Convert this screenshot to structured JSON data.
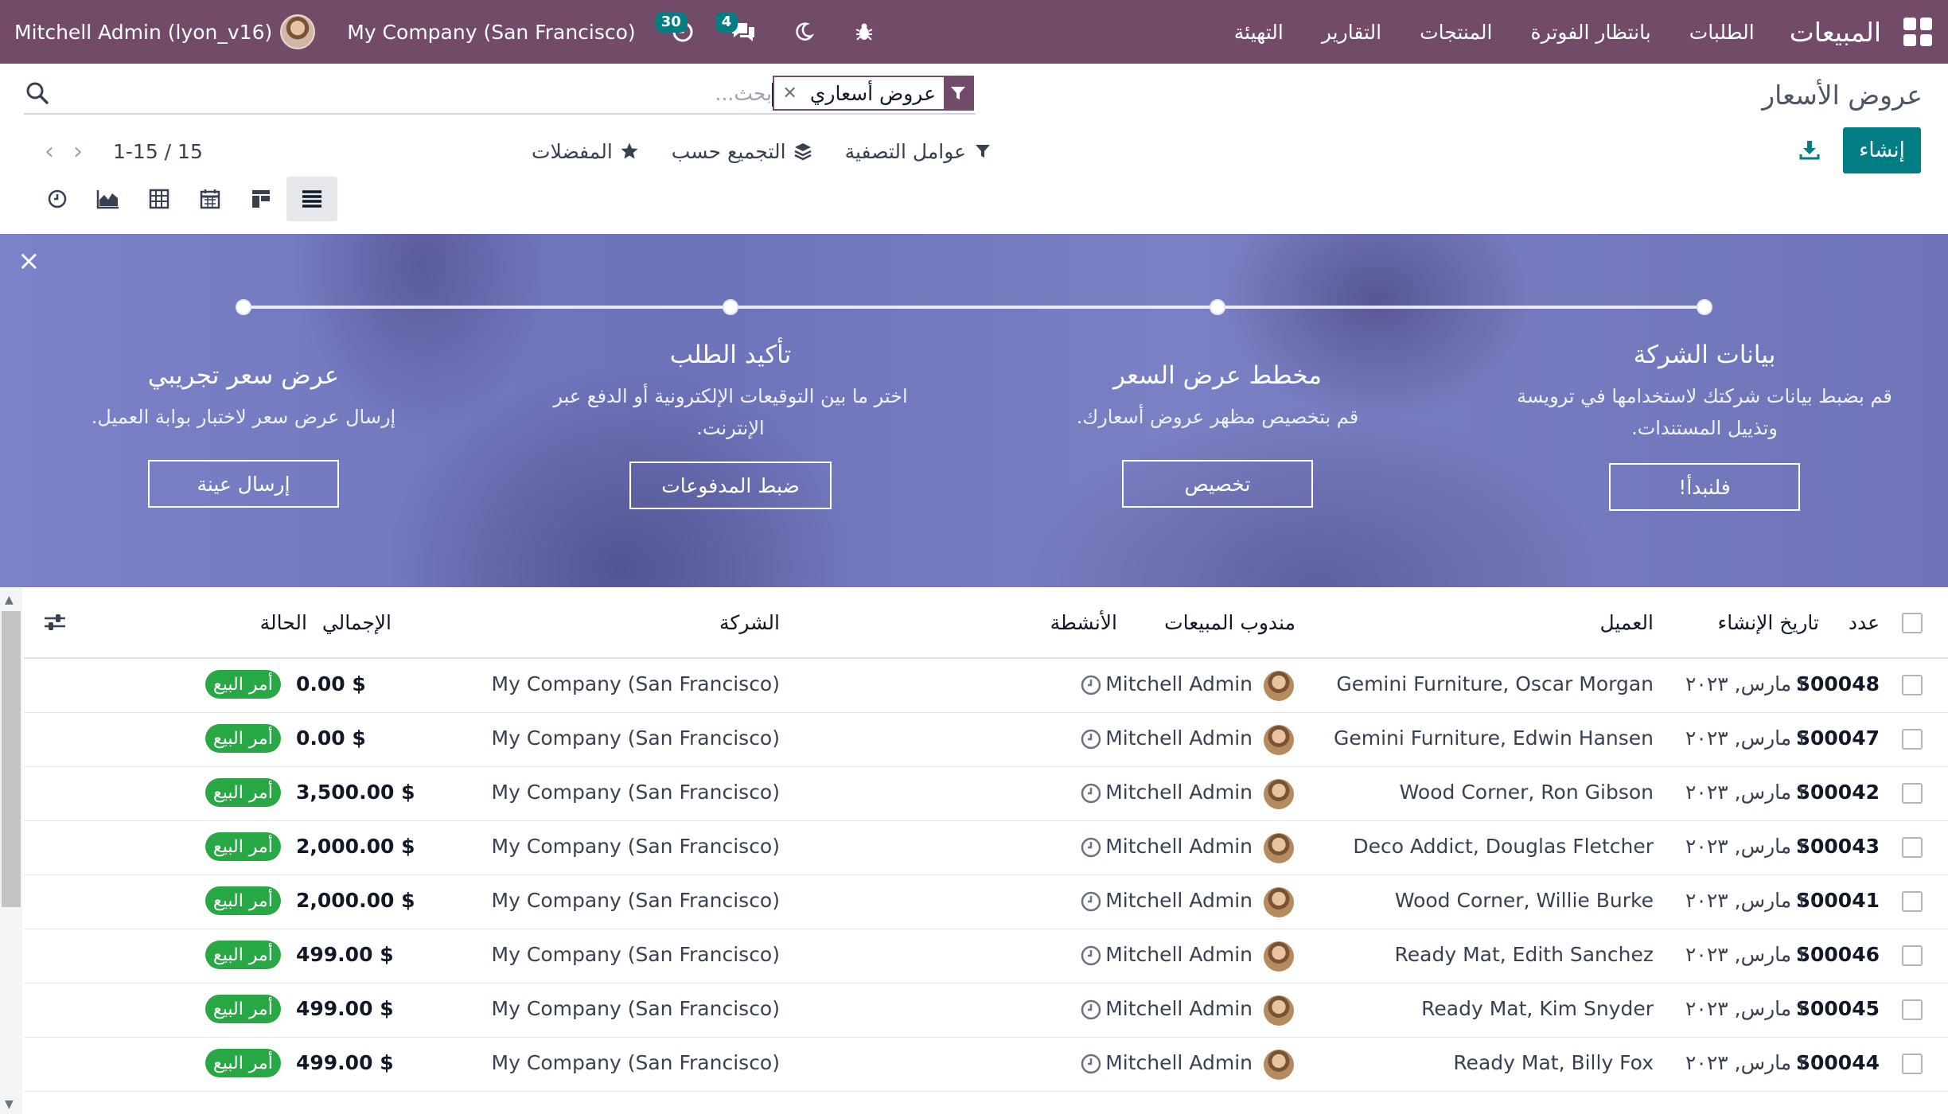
{
  "navbar": {
    "user": "Mitchell Admin (lyon_v16)",
    "company": "My Company (San Francisco)",
    "activity_count": "30",
    "message_count": "4",
    "brand": "المبيعات",
    "menu": [
      "الطلبات",
      "بانتظار الفوترة",
      "المنتجات",
      "التقارير",
      "التهيئة"
    ]
  },
  "control": {
    "breadcrumb": "عروض الأسعار",
    "search_facet": "عروض أسعاري",
    "search_placeholder": "بحث...",
    "create_label": "إنشاء",
    "pager_value": "1-15 / 15",
    "filters_label": "عوامل التصفية",
    "groupby_label": "التجميع حسب",
    "favorites_label": "المفضلات"
  },
  "banner": {
    "steps": [
      {
        "title": "بيانات الشركة",
        "desc": "قم بضبط بيانات شركتك لاستخدامها في ترويسة وتذييل المستندات.",
        "button": "فلنبدأ!"
      },
      {
        "title": "مخطط عرض السعر",
        "desc": "قم بتخصيص مظهر عروض أسعارك.",
        "button": "تخصيص"
      },
      {
        "title": "تأكيد الطلب",
        "desc": "اختر ما بين التوقيعات الإلكترونية أو الدفع عبر الإنترنت.",
        "button": "ضبط المدفوعات"
      },
      {
        "title": "عرض سعر تجريبي",
        "desc": "إرسال عرض سعر لاختبار بوابة العميل.",
        "button": "إرسال عينة"
      }
    ]
  },
  "table": {
    "headers": {
      "number": "عدد",
      "date": "تاريخ الإنشاء",
      "customer": "العميل",
      "salesperson": "مندوب المبيعات",
      "activities": "الأنشطة",
      "company": "الشركة",
      "total": "الإجمالي",
      "status": "الحالة"
    },
    "rows": [
      {
        "number": "S00048",
        "date": "٢٠ مارس, ٢٠٢٣",
        "customer": "Gemini Furniture, Oscar Morgan",
        "salesperson": "Mitchell Admin",
        "company": "My Company (San Francisco)",
        "total": "$ 0.00",
        "status": "أمر البيع"
      },
      {
        "number": "S00047",
        "date": "٢٠ مارس, ٢٠٢٣",
        "customer": "Gemini Furniture, Edwin Hansen",
        "salesperson": "Mitchell Admin",
        "company": "My Company (San Francisco)",
        "total": "$ 0.00",
        "status": "أمر البيع"
      },
      {
        "number": "S00042",
        "date": "٢٠ مارس, ٢٠٢٣",
        "customer": "Wood Corner, Ron Gibson",
        "salesperson": "Mitchell Admin",
        "company": "My Company (San Francisco)",
        "total": "$ 3,500.00",
        "status": "أمر البيع"
      },
      {
        "number": "S00043",
        "date": "٢٠ مارس, ٢٠٢٣",
        "customer": "Deco Addict, Douglas Fletcher",
        "salesperson": "Mitchell Admin",
        "company": "My Company (San Francisco)",
        "total": "$ 2,000.00",
        "status": "أمر البيع"
      },
      {
        "number": "S00041",
        "date": "٢٠ مارس, ٢٠٢٣",
        "customer": "Wood Corner, Willie Burke",
        "salesperson": "Mitchell Admin",
        "company": "My Company (San Francisco)",
        "total": "$ 2,000.00",
        "status": "أمر البيع"
      },
      {
        "number": "S00046",
        "date": "٢٠ مارس, ٢٠٢٣",
        "customer": "Ready Mat, Edith Sanchez",
        "salesperson": "Mitchell Admin",
        "company": "My Company (San Francisco)",
        "total": "$ 499.00",
        "status": "أمر البيع"
      },
      {
        "number": "S00045",
        "date": "٢٠ مارس, ٢٠٢٣",
        "customer": "Ready Mat, Kim Snyder",
        "salesperson": "Mitchell Admin",
        "company": "My Company (San Francisco)",
        "total": "$ 499.00",
        "status": "أمر البيع"
      },
      {
        "number": "S00044",
        "date": "٢٠ مارس, ٢٠٢٣",
        "customer": "Ready Mat, Billy Fox",
        "salesperson": "Mitchell Admin",
        "company": "My Company (San Francisco)",
        "total": "$ 499.00",
        "status": "أمر البيع"
      }
    ]
  },
  "colors": {
    "navbar": "#714b67",
    "primary": "#017e84",
    "status_success": "#28a745",
    "banner": "#7b82c8"
  }
}
